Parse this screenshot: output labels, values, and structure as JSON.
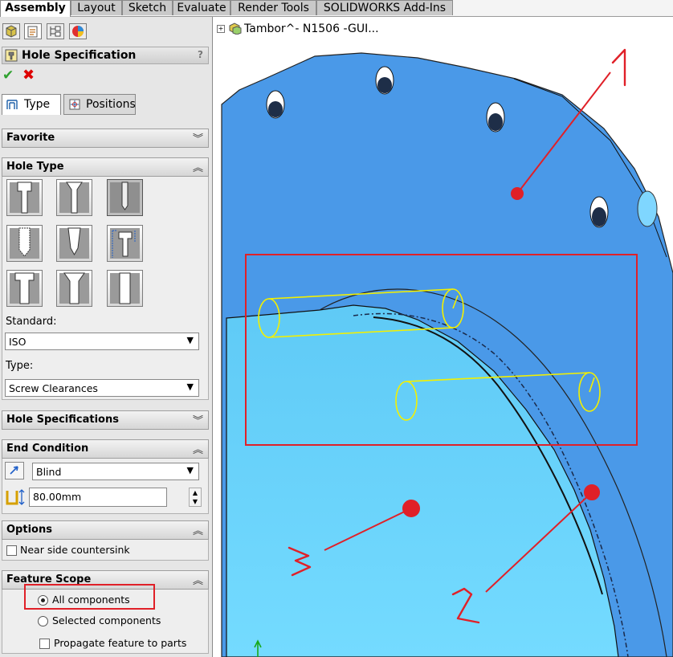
{
  "ribbon": {
    "tabs": [
      {
        "label": "Assembly"
      },
      {
        "label": "Layout"
      },
      {
        "label": "Sketch"
      },
      {
        "label": "Evaluate"
      },
      {
        "label": "Render Tools"
      },
      {
        "label": "SOLIDWORKS Add-Ins"
      }
    ]
  },
  "property_manager": {
    "title": "Hole Specification",
    "help": "?",
    "tabs": [
      {
        "label": "Type"
      },
      {
        "label": "Positions"
      }
    ],
    "sections": {
      "favorite": {
        "title": "Favorite"
      },
      "hole_type": {
        "title": "Hole Type",
        "standard_label": "Standard:",
        "standard_value": "ISO",
        "type_label": "Type:",
        "type_value": "Screw Clearances"
      },
      "hole_specifications": {
        "title": "Hole Specifications"
      },
      "end_condition": {
        "title": "End Condition",
        "condition_value": "Blind",
        "depth_value": "80.00mm"
      },
      "options": {
        "title": "Options",
        "near_side_countersink": "Near side countersink"
      },
      "feature_scope": {
        "title": "Feature Scope",
        "all_components": "All components",
        "selected_components": "Selected components",
        "propagate": "Propagate feature to parts"
      }
    }
  },
  "graphics": {
    "tree_item": "Tambor^- N1506 -GUI...",
    "annotations": [
      "1",
      "2",
      "3"
    ],
    "colors": {
      "part_dark": "#4a99e8",
      "part_light": "#66d4ff",
      "annotation": "#e02028",
      "axis_lines": "#f3f000"
    }
  }
}
